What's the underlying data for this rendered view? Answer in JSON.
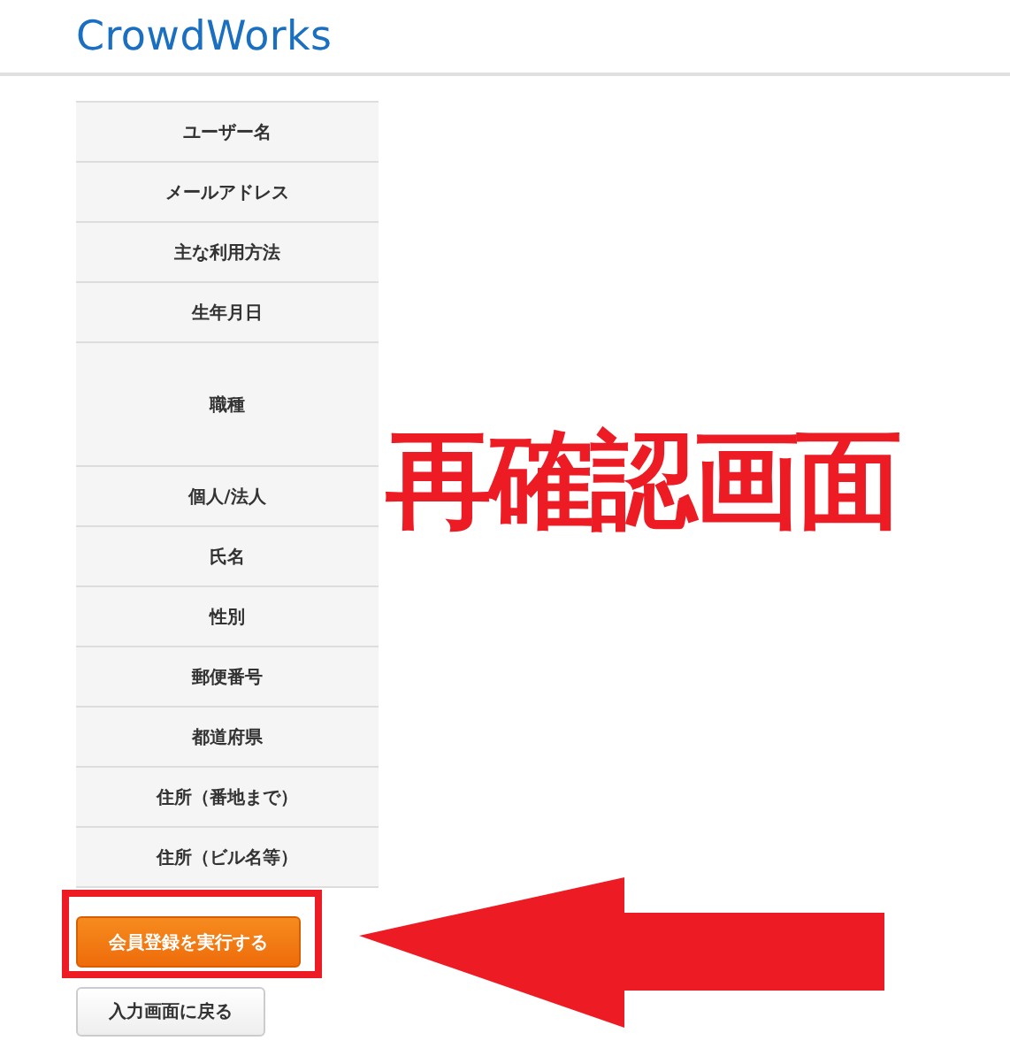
{
  "header": {
    "logo": "CrowdWorks"
  },
  "form_rows": [
    {
      "label": "ユーザー名",
      "kind": "single"
    },
    {
      "label": "メールアドレス",
      "kind": "single"
    },
    {
      "label": "主な利用方法",
      "kind": "single"
    },
    {
      "label": "生年月日",
      "kind": "single"
    },
    {
      "label": "職種",
      "kind": "tall"
    },
    {
      "label": "個人/法人",
      "kind": "single"
    },
    {
      "label": "氏名",
      "kind": "single"
    },
    {
      "label": "性別",
      "kind": "single"
    },
    {
      "label": "郵便番号",
      "kind": "single"
    },
    {
      "label": "都道府県",
      "kind": "single"
    },
    {
      "label": "住所（番地まで）",
      "kind": "single"
    },
    {
      "label": "住所（ビル名等）",
      "kind": "single"
    }
  ],
  "buttons": [
    {
      "label": "会員登録を実行する",
      "kind": "primary"
    },
    {
      "label": "入力画面に戻る",
      "kind": "secondary"
    }
  ],
  "annotation": {
    "caption": "再確認画面"
  }
}
